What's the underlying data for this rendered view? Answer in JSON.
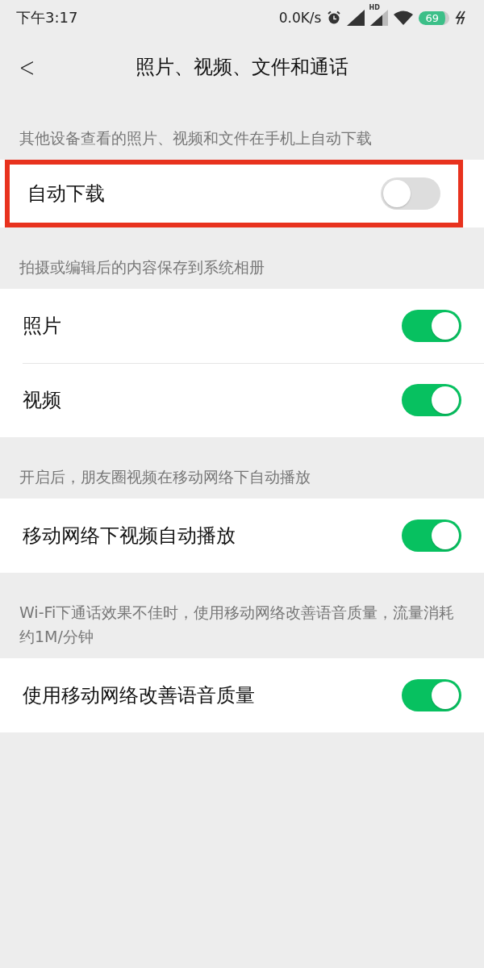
{
  "status_bar": {
    "time": "下午3:17",
    "speed": "0.0K/s",
    "network_label": "HD",
    "battery": "69"
  },
  "nav": {
    "back": "<",
    "title": "照片、视频、文件和通话"
  },
  "sections": [
    {
      "caption": "其他设备查看的照片、视频和文件在手机上自动下载",
      "rows": [
        {
          "label": "自动下载",
          "on": false,
          "highlighted": true
        }
      ]
    },
    {
      "caption": "拍摄或编辑后的内容保存到系统相册",
      "rows": [
        {
          "label": "照片",
          "on": true,
          "highlighted": false
        },
        {
          "label": "视频",
          "on": true,
          "highlighted": false
        }
      ]
    },
    {
      "caption": "开启后，朋友圈视频在移动网络下自动播放",
      "rows": [
        {
          "label": "移动网络下视频自动播放",
          "on": true,
          "highlighted": false
        }
      ]
    },
    {
      "caption": "Wi-Fi下通话效果不佳时，使用移动网络改善语音质量，流量消耗约1M/分钟",
      "rows": [
        {
          "label": "使用移动网络改善语音质量",
          "on": true,
          "highlighted": false
        }
      ]
    }
  ]
}
